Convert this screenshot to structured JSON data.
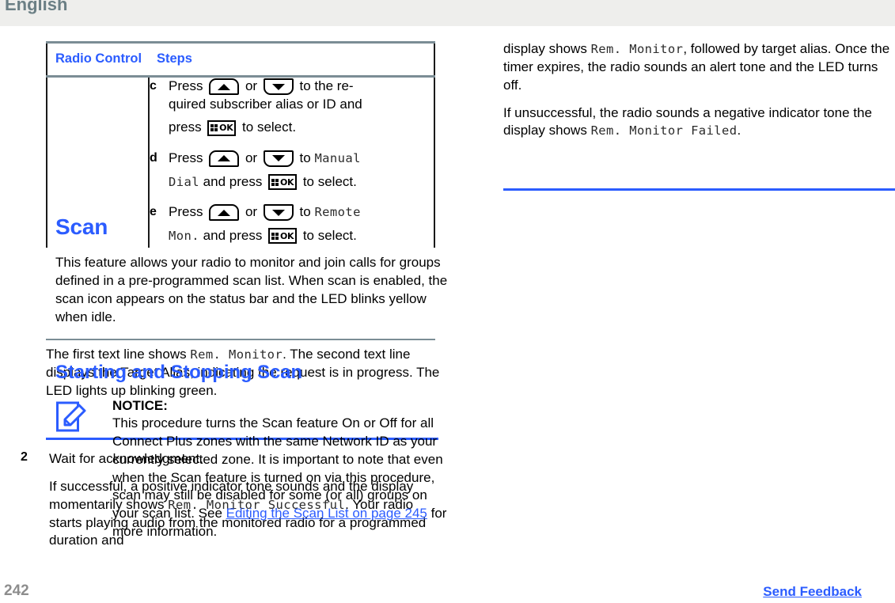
{
  "header": {
    "language": "English"
  },
  "colors": {
    "link_blue": "#2b5cff",
    "heading_blue": "#2b5cff",
    "header_text_gray": "#6b7f85",
    "header_band": "#eeeeec",
    "table_rule": "#7b8d95",
    "folio_gray": "#8d8d8d"
  },
  "table": {
    "headers": {
      "radio_control": "Radio Control",
      "steps": "Steps"
    },
    "substeps": [
      {
        "marker": "c",
        "line1_a": "Press",
        "line1_b": "or",
        "line1_c": "to the re-",
        "line2": "quired subscriber alias or ID and",
        "line3_a": "press",
        "line3_b": "to select."
      },
      {
        "marker": "d",
        "line1_a": "Press",
        "line1_b": "or",
        "line1_c": "to",
        "line1_mono": "Manual",
        "line2_mono": "Dial",
        "line2_a": "and press",
        "line2_b": "to select."
      },
      {
        "marker": "e",
        "line1_a": "Press",
        "line1_b": "or",
        "line1_c": "to",
        "line1_mono": "Remote",
        "line2_mono": "Mon.",
        "line2_a": "and press",
        "line2_b": "to select."
      }
    ]
  },
  "icons": {
    "up_key": "channel-up-button-icon",
    "down_key": "channel-down-button-icon",
    "ok_key": "menu-ok-button-icon",
    "notice": "notice-note-pencil-icon"
  },
  "left_column": {
    "after_table": {
      "p1_a": "The first text line shows",
      "p1_mono": "Rem. Monitor",
      "p1_b": ". The second text line displays the Target Alias, indicating the request is in progress. The LED lights up blinking green."
    },
    "step2": {
      "number": "2",
      "title": "Wait for acknowledgment.",
      "p_a": "If successful, a positive indicator tone sounds and the display momentarily shows",
      "p_mono1": "Rem. Monitor Successful",
      "p_b": ". Your radio starts playing audio from the monitored radio for a programmed duration and"
    }
  },
  "right_column": {
    "continued": {
      "p1_a": "display shows",
      "p1_mono": "Rem. Monitor",
      "p1_b": ", followed by target alias. Once the timer expires, the radio sounds an alert tone and the LED turns off.",
      "p2_a": "If unsuccessful, the radio sounds a negative indicator tone the display shows",
      "p2_mono": "Rem. Monitor Failed",
      "p2_b": "."
    },
    "scan_heading": "Scan",
    "scan_intro": "This feature allows your radio to monitor and join calls for groups defined in a pre-programmed scan list. When scan is enabled, the scan icon appears on the status bar and the LED blinks yellow when idle.",
    "start_stop_heading": "Starting and Stopping Scan",
    "notice": {
      "title": "NOTICE:",
      "body_a": "This procedure turns the Scan feature On or Off for all Connect Plus zones with the same Network ID as your currently selected zone. It is important to note that even when the Scan feature is turned on via this procedure, scan may still be disabled for some (or all) groups on your scan list. See",
      "link": "Editing the Scan List on page 245",
      "body_b": "for more information."
    }
  },
  "footer": {
    "page_number": "242",
    "send_feedback": "Send Feedback"
  }
}
